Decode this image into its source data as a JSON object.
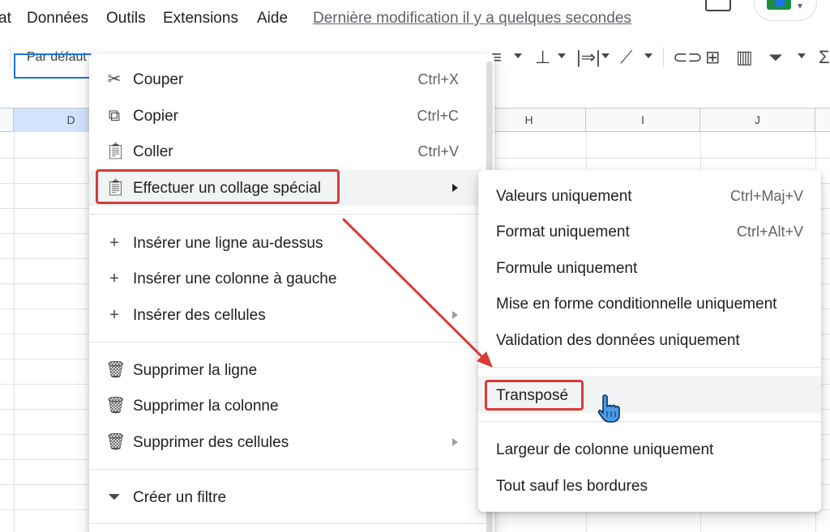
{
  "menubar": {
    "items": [
      "at",
      "Données",
      "Outils",
      "Extensions",
      "Aide"
    ],
    "last_modified": "Dernière modification il y a quelques secondes"
  },
  "toolbar": {
    "font": "Par défaut",
    "icons": [
      "align-left-icon",
      "vertical-align-icon",
      "text-direction-icon",
      "text-rotation-icon",
      "link-icon",
      "insert-comment-icon",
      "insert-chart-icon",
      "filter-icon",
      "functions-icon"
    ]
  },
  "grid": {
    "columns": [
      "D",
      "H",
      "I",
      "J"
    ]
  },
  "context_menu": {
    "items": [
      {
        "label": "Couper",
        "shortcut": "Ctrl+X",
        "icon": "cut-icon"
      },
      {
        "label": "Copier",
        "shortcut": "Ctrl+C",
        "icon": "copy-icon"
      },
      {
        "label": "Coller",
        "shortcut": "Ctrl+V",
        "icon": "paste-icon"
      },
      {
        "label": "Effectuer un collage spécial",
        "shortcut": "",
        "icon": "paste-special-icon"
      },
      {
        "label": "Insérer une ligne au-dessus",
        "shortcut": "",
        "icon": "plus-icon"
      },
      {
        "label": "Insérer une colonne à gauche",
        "shortcut": "",
        "icon": "plus-icon"
      },
      {
        "label": "Insérer des cellules",
        "shortcut": "",
        "icon": "plus-icon"
      },
      {
        "label": "Supprimer la ligne",
        "shortcut": "",
        "icon": "trash-icon"
      },
      {
        "label": "Supprimer la colonne",
        "shortcut": "",
        "icon": "trash-icon"
      },
      {
        "label": "Supprimer des cellules",
        "shortcut": "",
        "icon": "trash-icon"
      },
      {
        "label": "Créer un filtre",
        "shortcut": "",
        "icon": "filter-icon"
      }
    ]
  },
  "submenu": {
    "items": [
      {
        "label": "Valeurs uniquement",
        "shortcut": "Ctrl+Maj+V"
      },
      {
        "label": "Format uniquement",
        "shortcut": "Ctrl+Alt+V"
      },
      {
        "label": "Formule uniquement",
        "shortcut": ""
      },
      {
        "label": "Mise en forme conditionnelle uniquement",
        "shortcut": ""
      },
      {
        "label": "Validation des données uniquement",
        "shortcut": ""
      },
      {
        "label": "Transposé",
        "shortcut": ""
      },
      {
        "label": "Largeur de colonne uniquement",
        "shortcut": ""
      },
      {
        "label": "Tout sauf les bordures",
        "shortcut": ""
      }
    ]
  },
  "colors": {
    "highlight": "#db3a3a",
    "selection": "#1a73e8",
    "hover": "#f1f3f4"
  }
}
